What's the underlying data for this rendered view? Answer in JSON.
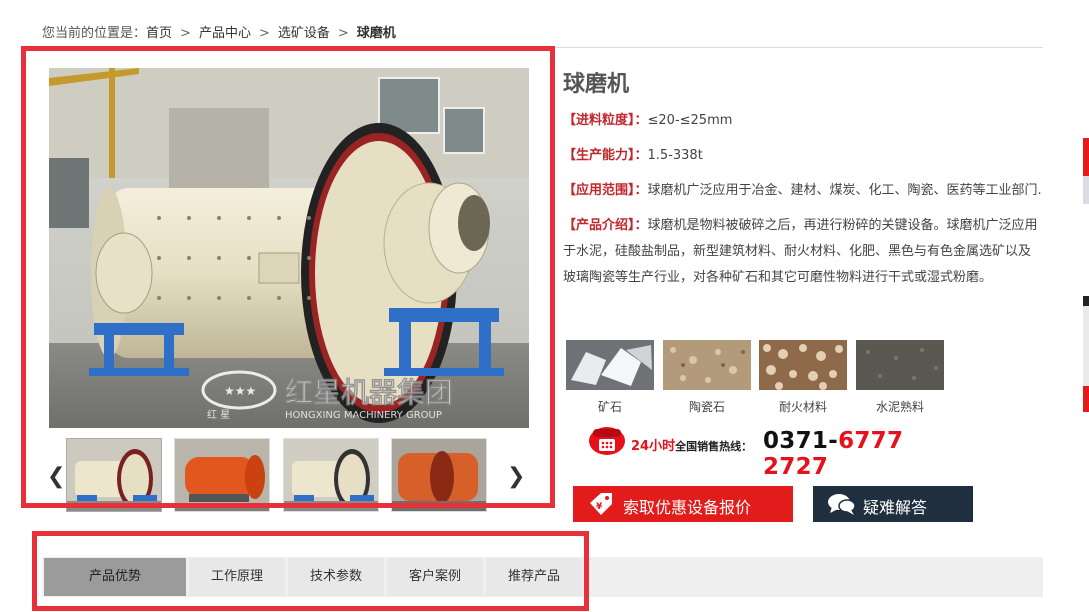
{
  "breadcrumb": {
    "prefix": "您当前的位置是：",
    "items": [
      "首页",
      "产品中心",
      "选矿设备",
      "球磨机"
    ],
    "separator": ">"
  },
  "gallery": {
    "watermark_brand": "红星机器集团",
    "watermark_sub": "HONGXING MACHINERY GROUP",
    "watermark_small": "红      星",
    "prev_label": "❮",
    "next_label": "❯"
  },
  "product": {
    "title": "球磨机",
    "specs": [
      {
        "key": "【进料粒度】：",
        "value": "≤20-≤25mm"
      },
      {
        "key": "【生产能力】：",
        "value": "1.5-338t"
      },
      {
        "key": "【应用范围】：",
        "value": "球磨机广泛应用于冶金、建材、煤炭、化工、陶瓷、医药等工业部门."
      },
      {
        "key": "【产品介绍】：",
        "value": "球磨机是物料被破碎之后，再进行粉碎的关键设备。球磨机广泛应用于水泥，硅酸盐制品，新型建筑材料、耐火材料、化肥、黑色与有色金属选矿以及玻璃陶瓷等生产行业，对各种矿石和其它可磨性物料进行干式或湿式粉磨。"
      }
    ],
    "materials": [
      "矿石",
      "陶瓷石",
      "耐火材料",
      "水泥熟料"
    ]
  },
  "hotline": {
    "lead": "24小时",
    "label": "全国销售热线：",
    "area": "0371-",
    "number": "6777 2727"
  },
  "buttons": {
    "quote": "索取优惠设备报价",
    "faq": "疑难解答"
  },
  "tabs": [
    "产品优势",
    "工作原理",
    "技术参数",
    "客户案例",
    "推荐产品"
  ],
  "colors": {
    "accent_red": "#e21b1b",
    "dark_button": "#1f2f3f",
    "active_tab": "#9b9b9b",
    "highlight_box": "#e8303a"
  }
}
